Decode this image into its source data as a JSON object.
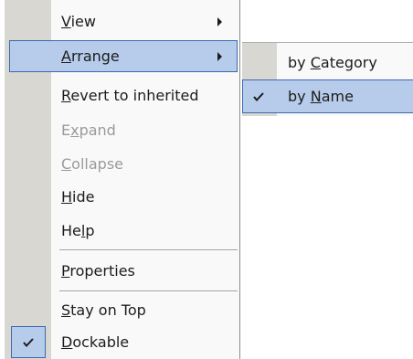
{
  "menu": {
    "items": [
      {
        "id": "view",
        "pre": "",
        "mn": "V",
        "post": "iew",
        "submenu": true,
        "disabled": false
      },
      {
        "id": "arrange",
        "pre": "",
        "mn": "A",
        "post": "rrange",
        "submenu": true,
        "disabled": false,
        "selected": true
      },
      {
        "id": "revert",
        "pre": "",
        "mn": "R",
        "post": "evert to inherited",
        "disabled": false
      },
      {
        "id": "expand",
        "pre": "E",
        "mn": "x",
        "post": "pand",
        "disabled": true
      },
      {
        "id": "collapse",
        "pre": "",
        "mn": "C",
        "post": "ollapse",
        "disabled": true
      },
      {
        "id": "hide",
        "pre": "",
        "mn": "H",
        "post": "ide",
        "disabled": false
      },
      {
        "id": "help",
        "pre": "He",
        "mn": "l",
        "post": "p",
        "disabled": false
      },
      {
        "id": "properties",
        "pre": "",
        "mn": "P",
        "post": "roperties",
        "disabled": false
      },
      {
        "id": "stay_on_top",
        "pre": "",
        "mn": "S",
        "post": "tay on Top",
        "disabled": false
      },
      {
        "id": "dockable",
        "pre": "",
        "mn": "D",
        "post": "ockable",
        "disabled": false,
        "checked": true
      }
    ]
  },
  "submenu": {
    "items": [
      {
        "id": "by_category",
        "pre": "by ",
        "mn": "C",
        "post": "ategory",
        "checked": false
      },
      {
        "id": "by_name",
        "pre": "by ",
        "mn": "N",
        "post": "ame",
        "checked": true,
        "selected": true
      }
    ]
  },
  "icons": {
    "check": "check-icon",
    "arrow": "submenu-arrow-icon"
  },
  "colors": {
    "highlight": "#b6ccea",
    "highlight_border": "#3b69b0",
    "gutter": "#d8d7d2",
    "disabled_text": "#9a9a9a"
  }
}
